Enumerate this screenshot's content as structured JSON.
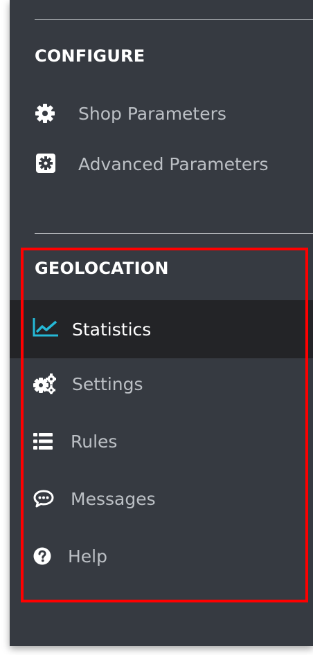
{
  "configure": {
    "title": "CONFIGURE",
    "items": [
      {
        "label": "Shop Parameters",
        "icon": "gear-icon"
      },
      {
        "label": "Advanced Parameters",
        "icon": "gear-box-icon"
      }
    ]
  },
  "geolocation": {
    "title": "GEOLOCATION",
    "items": [
      {
        "label": "Statistics",
        "icon": "line-chart-icon",
        "active": true
      },
      {
        "label": "Settings",
        "icon": "gears-icon",
        "active": false
      },
      {
        "label": "Rules",
        "icon": "list-icon",
        "active": false
      },
      {
        "label": "Messages",
        "icon": "speech-bubble-icon",
        "active": false
      },
      {
        "label": "Help",
        "icon": "question-circle-icon",
        "active": false
      }
    ]
  },
  "colors": {
    "sidebar_bg": "#363a41",
    "active_bg": "#232427",
    "accent": "#25b9d7",
    "highlight": "#ff0000",
    "text_muted": "#bcc0c5",
    "text_active": "#ffffff"
  }
}
